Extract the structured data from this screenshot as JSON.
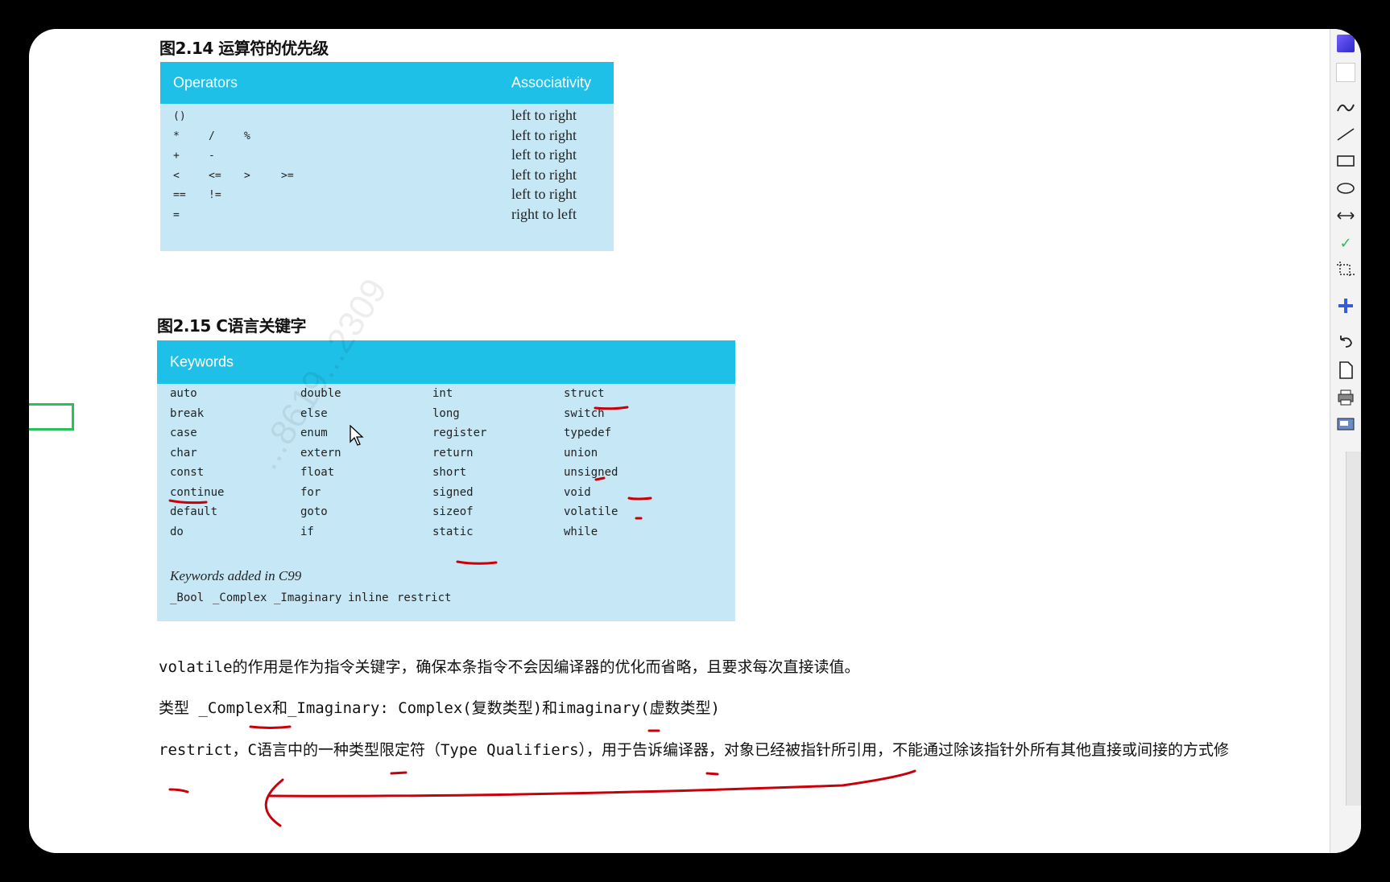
{
  "figures": {
    "operators": {
      "title": "图2.14 运算符的优先级",
      "header": {
        "col1": "Operators",
        "col2": "Associativity"
      },
      "rows": [
        {
          "ops": [
            "()"
          ],
          "assoc": "left to right"
        },
        {
          "ops": [
            "*",
            "/",
            "%"
          ],
          "assoc": "left to right"
        },
        {
          "ops": [
            "+",
            "-"
          ],
          "assoc": "left to right"
        },
        {
          "ops": [
            "<",
            "<=",
            ">",
            ">="
          ],
          "assoc": "left to right"
        },
        {
          "ops": [
            "==",
            "!="
          ],
          "assoc": "left to right"
        },
        {
          "ops": [
            "="
          ],
          "assoc": "right to left"
        }
      ]
    },
    "keywords": {
      "title": "图2.15 C语言关键字",
      "header": "Keywords",
      "columns": [
        [
          "auto",
          "break",
          "case",
          "char",
          "const",
          "continue",
          "default",
          "do"
        ],
        [
          "double",
          "else",
          "enum",
          "extern",
          "float",
          "for",
          "goto",
          "if"
        ],
        [
          "int",
          "long",
          "register",
          "return",
          "short",
          "signed",
          "sizeof",
          "static"
        ],
        [
          "struct",
          "switch",
          "typedef",
          "union",
          "unsigned",
          "void",
          "volatile",
          "while"
        ]
      ],
      "c99_label": "Keywords added in C99",
      "c99": [
        "_Bool",
        "_Complex",
        "_Imaginary",
        "inline",
        "restrict"
      ]
    }
  },
  "notes": {
    "line1": "volatile的作用是作为指令关键字，确保本条指令不会因编译器的优化而省略，且要求每次直接读值。",
    "line2": "类型 _Complex和_Imaginary: Complex(复数类型)和imaginary(虚数类型)",
    "line3": "restrict，C语言中的一种类型限定符（Type Qualifiers），用于告诉编译器，对象已经被指针所引用，不能通过除该指针外所有其他直接或间接的方式修"
  },
  "watermark": "...8619...2309",
  "toolbar": {
    "tools": [
      "color-swatch-icon",
      "eraser-icon",
      "freehand-pen-icon",
      "line-icon",
      "rectangle-icon",
      "ellipse-icon",
      "double-arrow-icon",
      "check-icon",
      "crop-icon",
      "move-cross-icon",
      "undo-icon",
      "new-page-icon",
      "print-icon",
      "screen-icon"
    ]
  },
  "annotation_color": "#c8000a",
  "accent_header": "#1fc0e7",
  "table_bg": "#c6e8f6"
}
